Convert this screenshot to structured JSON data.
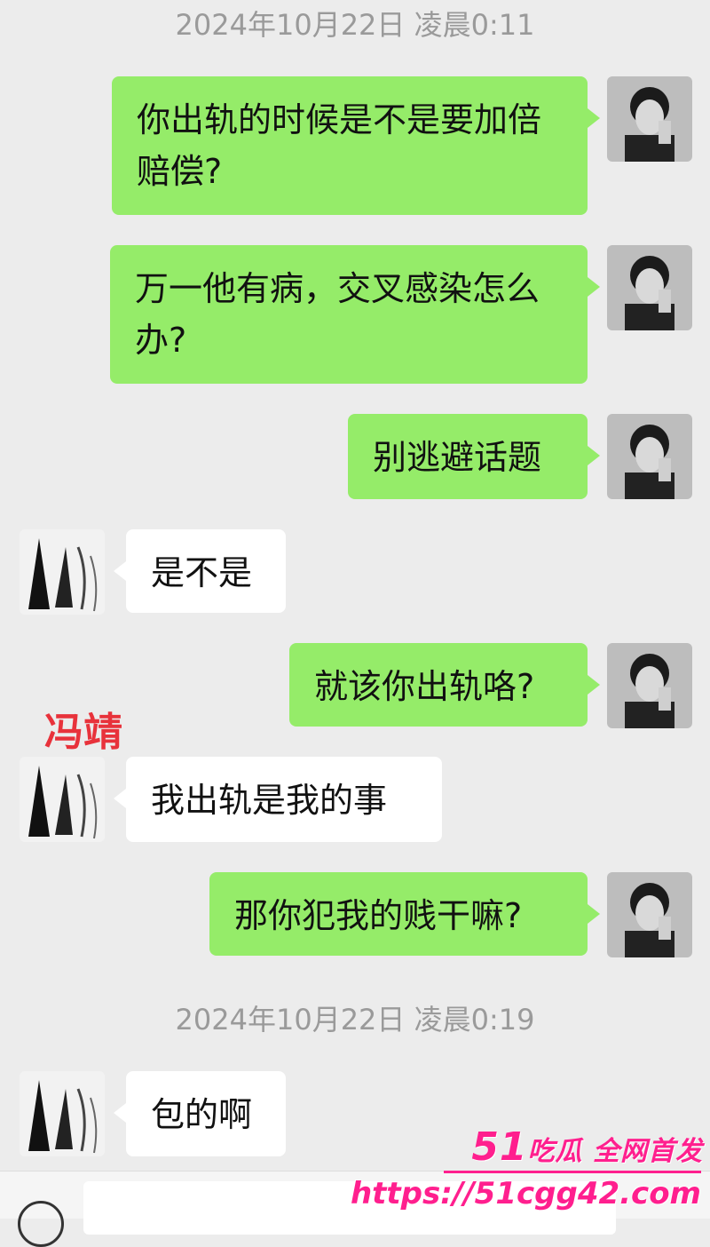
{
  "timestamps": [
    "2024年10月22日 凌晨0:11",
    "2024年10月22日 凌晨0:19"
  ],
  "messages": [
    {
      "side": "right",
      "text": "你出轨的时候是不是要加倍赔偿?"
    },
    {
      "side": "right",
      "text": "万一他有病，交叉感染怎么办?"
    },
    {
      "side": "right",
      "text": "别逃避话题"
    },
    {
      "side": "left",
      "text": "是不是"
    },
    {
      "side": "right",
      "text": "就该你出轨咯?"
    },
    {
      "side": "left",
      "text": "我出轨是我的事"
    },
    {
      "side": "right",
      "text": "那你犯我的贱干嘛?"
    },
    {
      "side": "left",
      "text": "包的啊"
    }
  ],
  "label": "冯靖",
  "watermark": {
    "logo_num": "51",
    "logo_text": "吃瓜 全网首发",
    "url": "https://51cgg42.com"
  },
  "colors": {
    "sent_bubble": "#95ec69",
    "received_bubble": "#ffffff",
    "background": "#ececec",
    "label": "#e8323b",
    "watermark": "#ff1f8e"
  }
}
